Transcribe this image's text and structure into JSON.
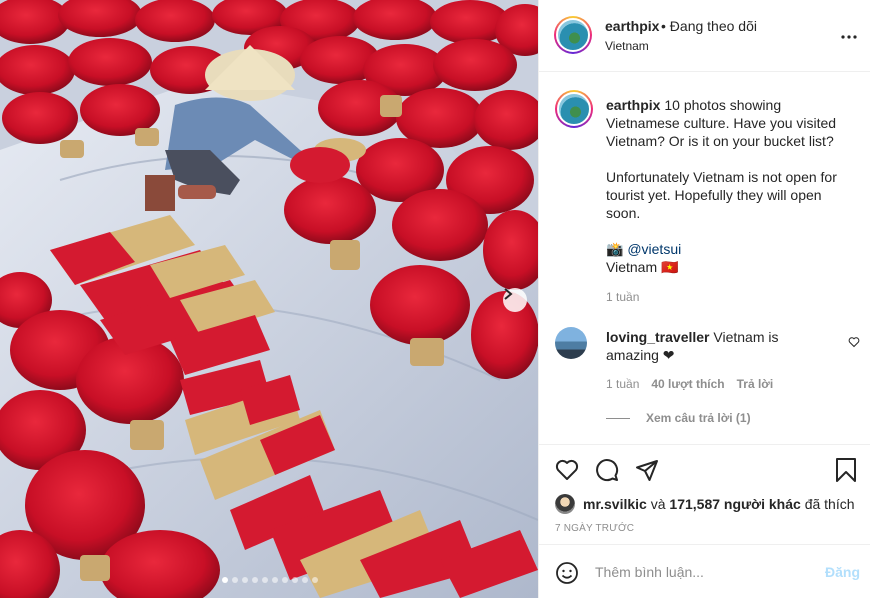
{
  "post": {
    "carousel_slides": 12,
    "carousel_active_index": 0,
    "photo_description_icons": [
      "chevron-right-icon"
    ]
  },
  "header": {
    "username": "earthpix",
    "follow_text": "• Đang theo dõi",
    "location": "Vietnam"
  },
  "caption": {
    "username": "earthpix",
    "line1": "10 photos showing Vietnamese culture. Have you visited Vietnam? Or is it on your bucket list?",
    "line2": "Unfortunately Vietnam is not open for tourist yet. Hopefully they will open soon.",
    "credit_prefix": "📸",
    "credit_handle": "@vietsui",
    "tag_line": "Vietnam 🇻🇳",
    "time": "1 tuần"
  },
  "comment": {
    "username": "loving_traveller",
    "text": "Vietnam is amazing ❤",
    "time": "1 tuần",
    "likes": "40 lượt thích",
    "reply_label": "Trả lời",
    "view_replies": "Xem câu trả lời (1)"
  },
  "likes": {
    "user": "mr.svilkic",
    "conj": "và",
    "others": "171,587 người khác",
    "suffix": "đã thích"
  },
  "post_date": "7 NGÀY TRƯỚC",
  "comment_box": {
    "placeholder": "Thêm bình luận...",
    "post_label": "Đăng"
  },
  "colors": {
    "incense_red": "#d4112a",
    "mention_blue": "#00376b",
    "disabled_post": "#b2dffc",
    "muted_text": "#8e8e8e"
  }
}
